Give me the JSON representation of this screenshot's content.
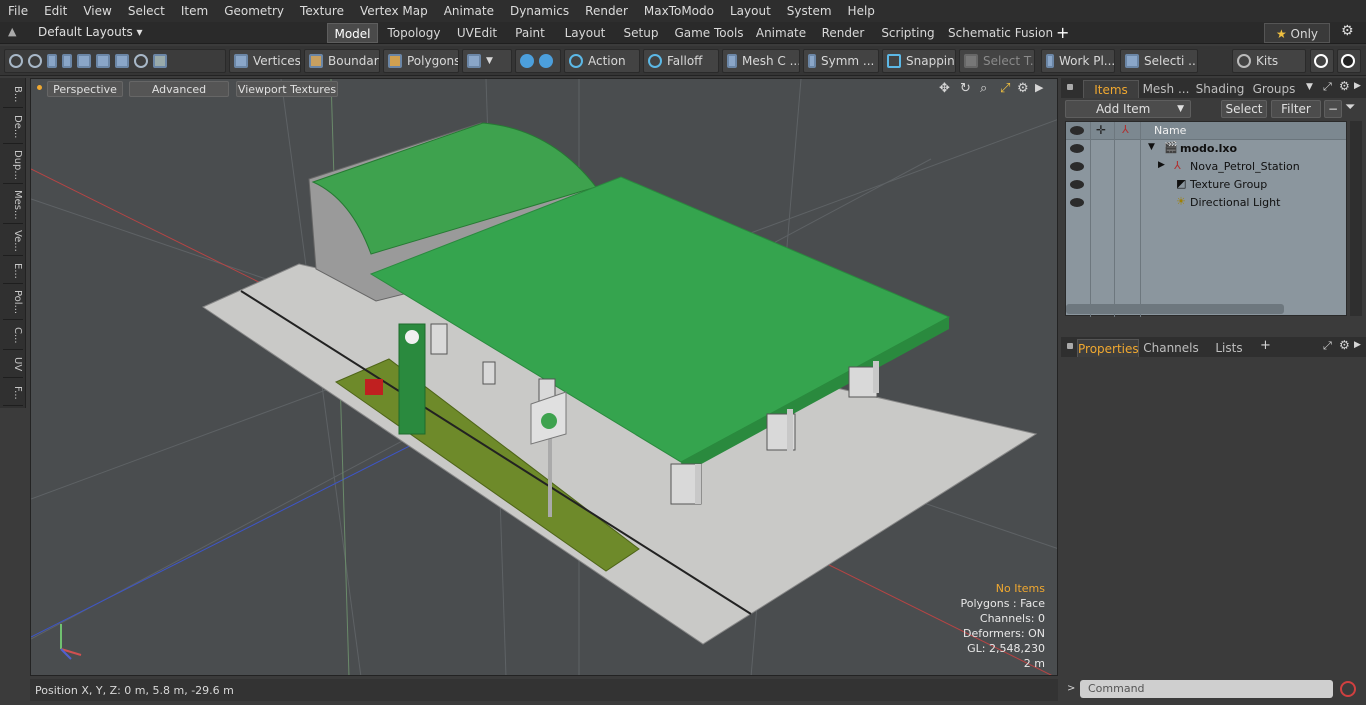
{
  "menu": [
    "File",
    "Edit",
    "View",
    "Select",
    "Item",
    "Geometry",
    "Texture",
    "Vertex Map",
    "Animate",
    "Dynamics",
    "Render",
    "MaxToModo",
    "Layout",
    "System",
    "Help"
  ],
  "layouts": {
    "label": "Default Layouts"
  },
  "mode_tabs": [
    "Model",
    "Topology",
    "UVEdit",
    "Paint",
    "Layout",
    "Setup",
    "Game Tools",
    "Animate",
    "Render",
    "Scripting",
    "Schematic Fusion"
  ],
  "only_label": "Only",
  "toolbar": {
    "vertices": "Vertices",
    "boundary": "Boundary",
    "polygons": "Polygons",
    "action": "Action",
    "falloff": "Falloff",
    "mesh": "Mesh C ...",
    "symm": "Symm ...",
    "snapping": "Snapping",
    "select_t": "Select T...",
    "workplane": "Work Pl...",
    "selecti": "Selecti ...",
    "kits": "Kits"
  },
  "left_tabs": [
    "B...",
    "De...",
    "Dup...",
    "Mes...",
    "Ve...",
    "E...",
    "Pol...",
    "C...",
    "UV",
    "F..."
  ],
  "viewport": {
    "perspective": "Perspective",
    "advanced": "Advanced",
    "textures": "Viewport Textures",
    "stats": {
      "no_items": "No Items",
      "polygons": "Polygons : Face",
      "channels": "Channels: 0",
      "deformers": "Deformers: ON",
      "gl": "GL: 2,548,230",
      "scale": "2 m"
    }
  },
  "status": {
    "position": "Position X, Y, Z:   0 m, 5.8 m, -29.6 m"
  },
  "items_panel": {
    "tabs": [
      "Items",
      "Mesh ...",
      "Shading",
      "Groups"
    ],
    "add_item": "Add Item",
    "select": "Select",
    "filter": "Filter",
    "name_header": "Name",
    "tree": [
      "modo.lxo",
      "Nova_Petrol_Station",
      "Texture Group",
      "Directional Light"
    ]
  },
  "props_panel": {
    "tabs": [
      "Properties",
      "Channels",
      "Lists"
    ]
  },
  "command": {
    "placeholder": "Command"
  }
}
